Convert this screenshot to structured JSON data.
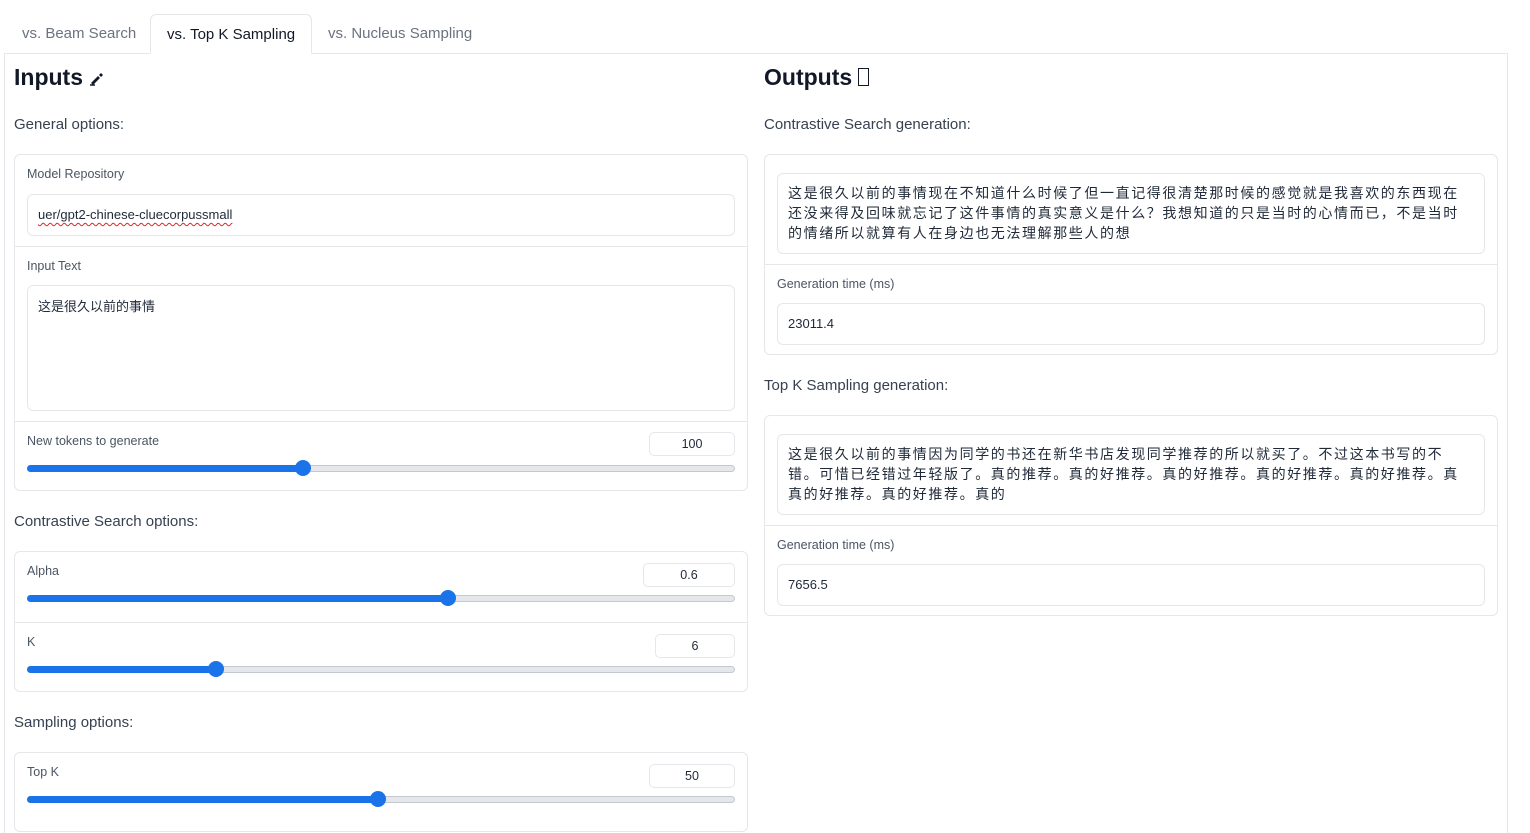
{
  "tabs": [
    {
      "label": "vs. Beam Search",
      "active": false
    },
    {
      "label": "vs. Top K Sampling",
      "active": true
    },
    {
      "label": "vs. Nucleus Sampling",
      "active": false
    }
  ],
  "inputs": {
    "title": "Inputs",
    "title_icon": "writing-hand-icon",
    "general_label": "General options:",
    "model_repo_label": "Model Repository",
    "model_repo_value": "uer/gpt2-chinese-cluecorpussmall",
    "input_text_label": "Input Text",
    "input_text_value": "这是很久以前的事情",
    "new_tokens_label": "New tokens to generate",
    "new_tokens_value": "100",
    "new_tokens_fraction": 0.39,
    "contrastive_label": "Contrastive Search options:",
    "alpha_label": "Alpha",
    "alpha_value": "0.6",
    "alpha_fraction": 0.595,
    "k_label": "K",
    "k_value": "6",
    "k_fraction": 0.267,
    "sampling_label": "Sampling options:",
    "topk_label": "Top K",
    "topk_value": "50",
    "topk_fraction": 0.496
  },
  "outputs": {
    "title": "Outputs",
    "title_icon": "missing-glyph-box-icon",
    "contrastive_label": "Contrastive Search generation:",
    "contrastive_text": "这是很久以前的事情现在不知道什么时候了但一直记得很清楚那时候的感觉就是我喜欢的东西现在还没来得及回味就忘记了这件事情的真实意义是什么？我想知道的只是当时的心情而已，不是当时的情绪所以就算有人在身边也无法理解那些人的想",
    "contrastive_time_label": "Generation time (ms)",
    "contrastive_time_value": "23011.4",
    "topk_label": "Top K Sampling generation:",
    "topk_text": "这是很久以前的事情因为同学的书还在新华书店发现同学推荐的所以就买了。不过这本书写的不错。可惜已经错过年轻版了。真的推荐。真的好推荐。真的好推荐。真的好推荐。真的好推荐。真真的好推荐。真的好推荐。真的",
    "topk_time_label": "Generation time (ms)",
    "topk_time_value": "7656.5"
  },
  "colors": {
    "accent": "#1a73e8",
    "border": "#e5e7eb"
  }
}
